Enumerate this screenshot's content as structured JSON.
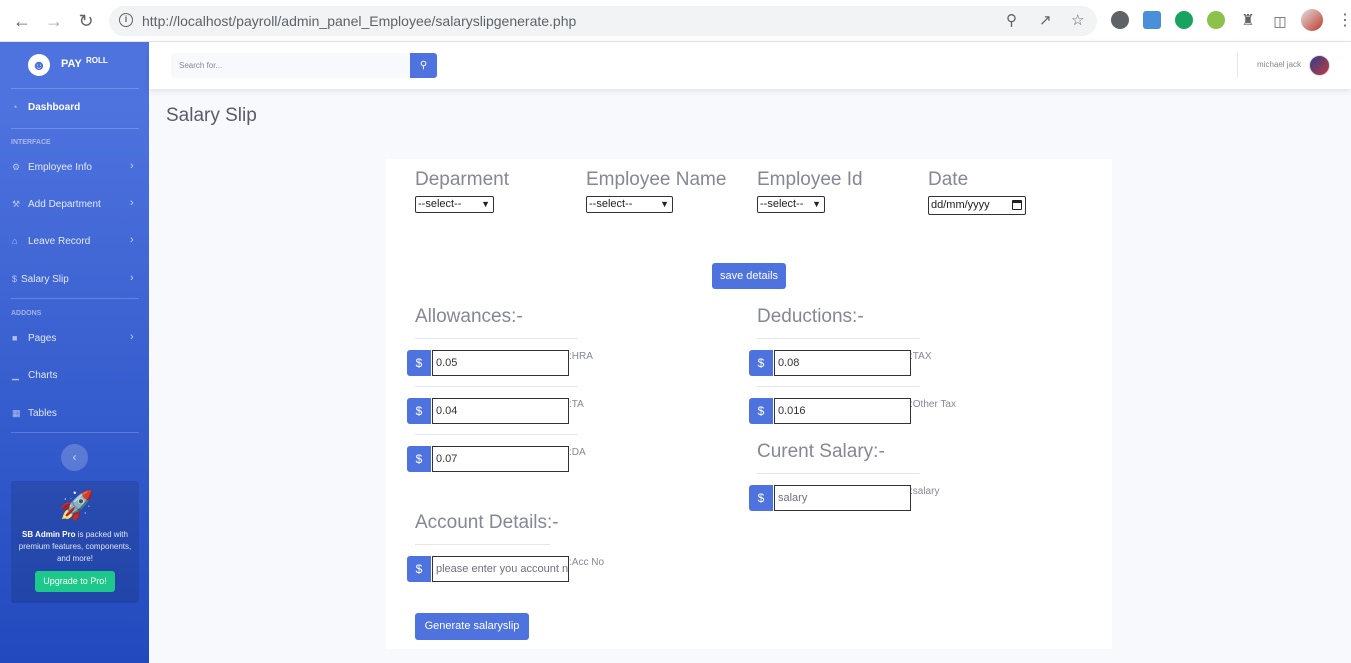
{
  "browser": {
    "url_host": "http://localhost",
    "url_path": "/payroll/admin_panel_Employee/salaryslipgenerate.php"
  },
  "sidebar": {
    "brand_main": "PAY",
    "brand_sup": "ROLL",
    "dashboard": "Dashboard",
    "heading_interface": "INTERFACE",
    "items_interface": [
      {
        "label": "Employee Info",
        "icon": "gear-icon"
      },
      {
        "label": "Add Department",
        "icon": "wrench-icon"
      },
      {
        "label": "Leave Record",
        "icon": "home-icon"
      },
      {
        "label": "Salary Slip",
        "icon": "dollar-icon"
      }
    ],
    "heading_addons": "ADDONS",
    "items_addons": [
      {
        "label": "Pages",
        "icon": "folder-icon"
      },
      {
        "label": "Charts",
        "icon": "chart-icon"
      },
      {
        "label": "Tables",
        "icon": "table-icon"
      }
    ],
    "promo_bold": "SB Admin Pro",
    "promo_text": " is packed with premium features, components, and more!",
    "promo_button": "Upgrade to Pro!"
  },
  "topbar": {
    "search_placeholder": "Search for...",
    "user_name": "michael jack"
  },
  "page_title": "Salary Slip",
  "form": {
    "department_label": "Deparment",
    "employee_name_label": "Employee Name",
    "employee_id_label": "Employee Id",
    "date_label": "Date",
    "select_value": "--select--",
    "date_value": "dd/mm/yyyy",
    "save_button": "save details",
    "allowances_heading": "Allowances:-",
    "deductions_heading": "Deductions:-",
    "current_salary_heading": "Curent Salary:-",
    "account_heading": "Account Details:-",
    "currency_symbol": "$",
    "hra_value": "0.05",
    "hra_suffix": ":HRA",
    "ta_value": "0.04",
    "ta_suffix": ":TA",
    "da_value": "0.07",
    "da_suffix": ":DA",
    "tax_value": "0.08",
    "tax_suffix": ":TAX",
    "other_tax_value": "0.016",
    "other_tax_suffix": ":Other Tax",
    "salary_placeholder": "salary",
    "salary_suffix": ":salary",
    "account_placeholder": "please enter you account no",
    "account_suffix": ":Acc No",
    "generate_button": "Generate salaryslip"
  }
}
